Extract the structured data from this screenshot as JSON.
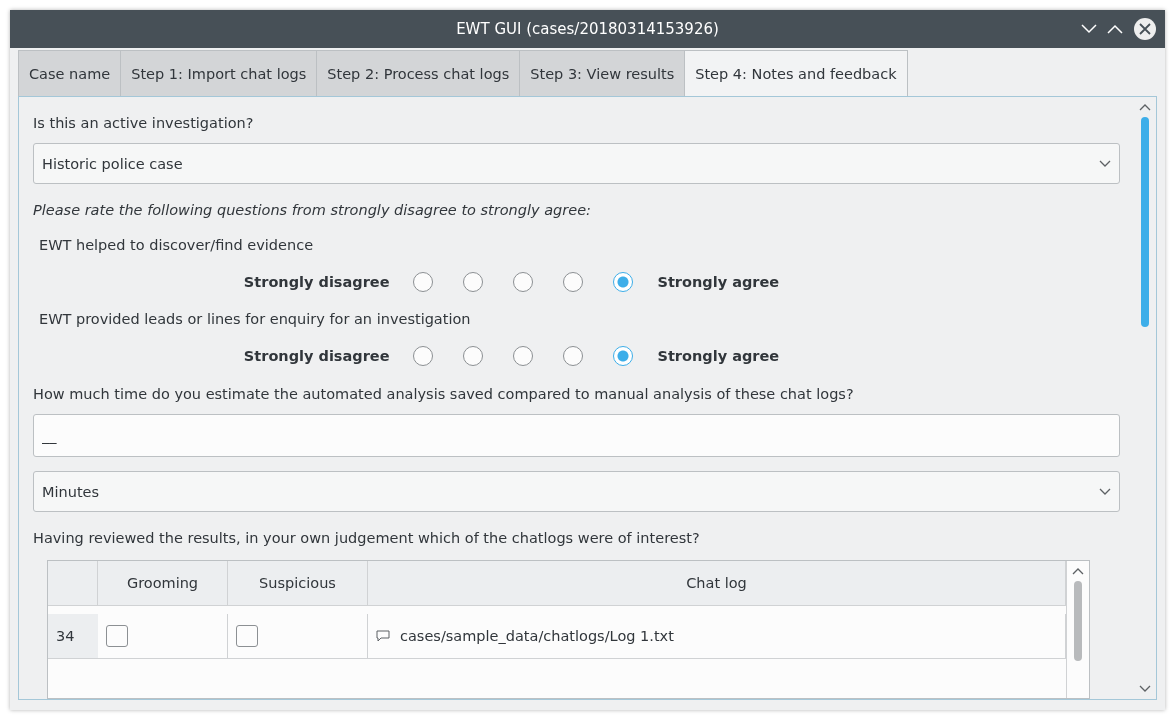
{
  "window": {
    "title": "EWT GUI (cases/20180314153926)"
  },
  "tabs": [
    {
      "label": "Case name",
      "selected": false
    },
    {
      "label": "Step 1: Import chat logs",
      "selected": false
    },
    {
      "label": "Step 2: Process chat logs",
      "selected": false
    },
    {
      "label": "Step 3: View results",
      "selected": false
    },
    {
      "label": "Step 4: Notes and feedback",
      "selected": true
    }
  ],
  "active_question": {
    "label": "Is this an active investigation?",
    "value": "Historic police case"
  },
  "rating_intro": "Please rate the following questions from strongly disagree to strongly agree:",
  "ratings": [
    {
      "label": "EWT helped to discover/find evidence",
      "low": "Strongly disagree",
      "high": "Strongly agree",
      "options": [
        {
          "selected": false
        },
        {
          "selected": false
        },
        {
          "selected": false
        },
        {
          "selected": false
        },
        {
          "selected": true
        }
      ]
    },
    {
      "label": "EWT provided leads or lines for enquiry for an investigation",
      "low": "Strongly disagree",
      "high": "Strongly agree",
      "options": [
        {
          "selected": false
        },
        {
          "selected": false
        },
        {
          "selected": false
        },
        {
          "selected": false
        },
        {
          "selected": true
        }
      ]
    }
  ],
  "time_question": {
    "label": "How much time do you estimate the automated analysis saved compared to manual analysis of these chat logs?",
    "value": "__",
    "unit": "Minutes"
  },
  "interest_question": "Having reviewed the results, in your own judgement which of the chatlogs were of interest?",
  "table": {
    "columns": [
      "Grooming",
      "Suspicious",
      "Chat log"
    ],
    "rows": [
      {
        "number": "34",
        "grooming": false,
        "suspicious": false,
        "log": "cases/sample_data/chatlogs/Log 1.txt"
      }
    ]
  }
}
